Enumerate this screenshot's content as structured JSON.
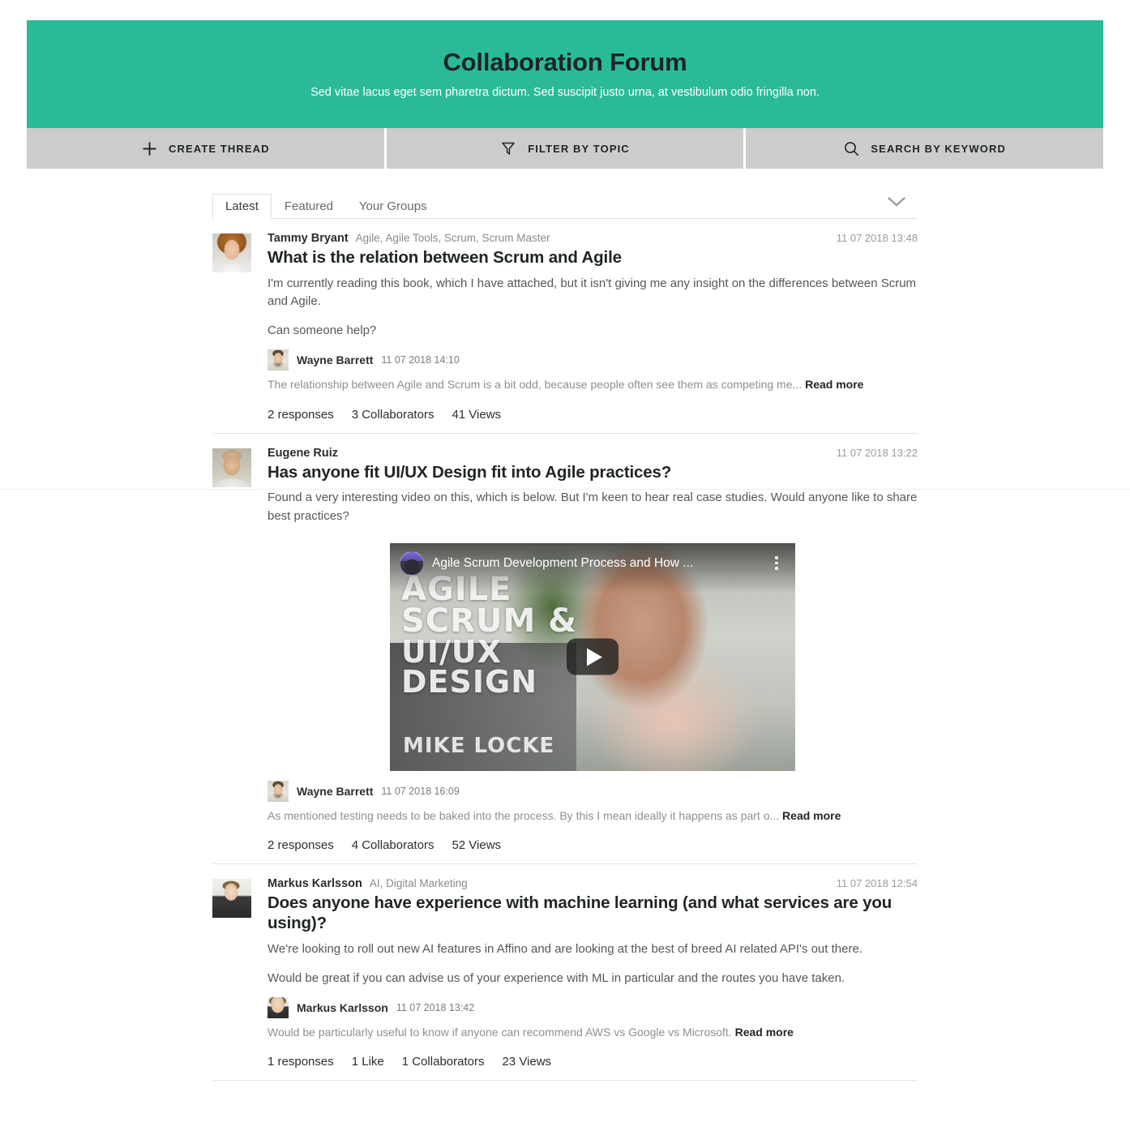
{
  "hero": {
    "title": "Collaboration Forum",
    "subtitle": "Sed vitae lacus eget sem pharetra dictum. Sed suscipit justo urna, at vestibulum odio fringilla non.",
    "bg_color": "#2BBA98"
  },
  "actionbar": {
    "bg_color": "#CCCCCC",
    "buttons": [
      {
        "label": "Create Thread",
        "icon": "plus-icon"
      },
      {
        "label": "Filter by Topic",
        "icon": "filter-icon"
      },
      {
        "label": "Search by Keyword",
        "icon": "search-icon"
      }
    ]
  },
  "tabs": {
    "items": [
      {
        "label": "Latest",
        "active": true
      },
      {
        "label": "Featured",
        "active": false
      },
      {
        "label": "Your Groups",
        "active": false
      }
    ],
    "chevron_icon": "chevron-down-icon"
  },
  "threads": [
    {
      "author": "Tammy Bryant",
      "topics": "Agile, Agile Tools, Scrum, Scrum Master",
      "timestamp": "11 07 2018 13:48",
      "title": "What is the relation between Scrum and Agile",
      "paragraphs": [
        "I'm currently reading this book, which I have attached, but it isn't giving me any insight on the differences between Scrum and Agile.",
        "Can someone help?"
      ],
      "reply": {
        "author": "Wayne Barrett",
        "timestamp": "11 07 2018 14:10",
        "text": "The relationship between Agile and Scrum is a bit odd, because people often see them as competing me...",
        "read_more": "Read more"
      },
      "stats": [
        "2 responses",
        "3 Collaborators",
        "41 Views"
      ]
    },
    {
      "author": "Eugene Ruiz",
      "topics": "",
      "timestamp": "11 07 2018 13:22",
      "title": "Has anyone fit UI/UX Design fit into Agile practices?",
      "paragraphs": [
        "Found a very interesting video on this, which is below. But I'm keen to hear real case studies. Would anyone like to share best practices?"
      ],
      "video": {
        "title": "Agile Scrum Development Process and How ...",
        "overlay_line1": "AGILE",
        "overlay_line2": "SCRUM &",
        "overlay_line3": "UI/UX DESIGN",
        "byline": "MIKE LOCKE",
        "play_icon": "play-icon",
        "menu_icon": "kebab-menu-icon"
      },
      "reply": {
        "author": "Wayne Barrett",
        "timestamp": "11 07 2018 16:09",
        "text": "As mentioned testing needs to be baked into the process. By this I mean ideally it happens as part o...",
        "read_more": "Read more"
      },
      "stats": [
        "2 responses",
        "4 Collaborators",
        "52 Views"
      ]
    },
    {
      "author": "Markus Karlsson",
      "topics": "AI, Digital Marketing",
      "timestamp": "11 07 2018 12:54",
      "title": "Does anyone have experience with machine learning (and what services are you using)?",
      "paragraphs": [
        "We're looking to roll out new AI features in Affino and are looking at the best of breed AI related API's out there.",
        "Would be great if you can advise us of your experience with ML in particular and the routes you have taken."
      ],
      "reply": {
        "author": "Markus Karlsson",
        "timestamp": "11 07 2018 13:42",
        "text": "Would be particularly useful to know if anyone can recommend AWS vs Google vs Microsoft.",
        "read_more": "Read more"
      },
      "stats": [
        "1 responses",
        "1 Like",
        "1 Collaborators",
        "23 Views"
      ]
    }
  ]
}
